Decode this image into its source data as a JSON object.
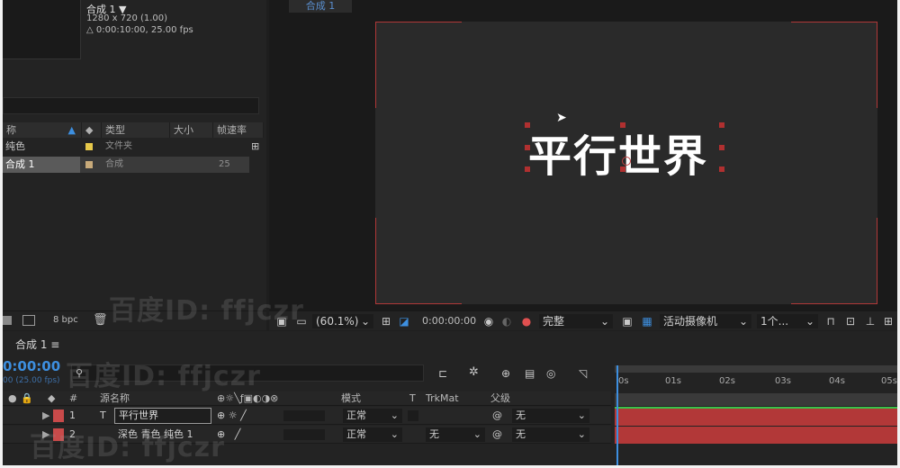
{
  "project": {
    "comp_name": "合成 1 ▼",
    "resolution": "1280 x 720 (1.00)",
    "duration": "△ 0:00:10:00, 25.00 fps",
    "columns": [
      "称",
      "类型",
      "大小",
      "帧速率"
    ],
    "items": [
      {
        "name": "纯色",
        "type": "文件夹",
        "fps": "",
        "color": "#e6c84a"
      },
      {
        "name": "合成 1",
        "type": "合成",
        "fps": "25",
        "color": "#c8aa7a"
      }
    ],
    "bpc": "8 bpc"
  },
  "viewer": {
    "tab": "合成 1",
    "canvas_text": "平行世界",
    "zoom": "(60.1%)",
    "timecode": "0:00:00:00",
    "resolution": "完整",
    "camera": "活动摄像机",
    "views": "1个..."
  },
  "timeline": {
    "tab": "合成 1",
    "timecode": "0:00:00",
    "fps": "00 (25.00 fps)",
    "search_placeholder": "",
    "columns": {
      "source_name": "源名称",
      "num": "#",
      "mode": "模式",
      "t": "T",
      "trkmat": "TrkMat",
      "parent": "父级"
    },
    "layers": [
      {
        "num": "1",
        "type_icon": "T",
        "name": "平行世界",
        "mode": "正常",
        "trkmat": "",
        "parent": "无",
        "color": "#c84a4a"
      },
      {
        "num": "2",
        "type_icon": "",
        "name": "深色 青色 纯色 1",
        "mode": "正常",
        "trkmat": "无",
        "parent": "无",
        "color": "#c84a4a"
      }
    ],
    "ruler_ticks": [
      "0s",
      "01s",
      "02s",
      "03s",
      "04s",
      "05s"
    ]
  },
  "watermark": "百度ID: ffjczr",
  "colors": {
    "accent": "#3d8fe0",
    "track": "#b23838",
    "bg": "#1e1e1e"
  }
}
